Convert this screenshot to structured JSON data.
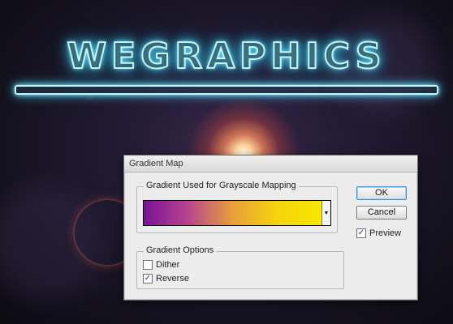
{
  "background": {
    "logo_text": "WEGRAPHICS",
    "glow_color": "#7fe9ff"
  },
  "dialog": {
    "title": "Gradient Map",
    "gradient_group_title": "Gradient Used for Grayscale Mapping",
    "gradient": {
      "colors": [
        "#7a1296",
        "#e79f3a",
        "#f7e800"
      ],
      "dropdown_icon": "triangle-down"
    },
    "options_group_title": "Gradient Options",
    "dither": {
      "label": "Dither",
      "checked": false
    },
    "reverse": {
      "label": "Reverse",
      "checked": true
    },
    "ok_label": "OK",
    "cancel_label": "Cancel",
    "preview": {
      "label": "Preview",
      "checked": true
    }
  }
}
